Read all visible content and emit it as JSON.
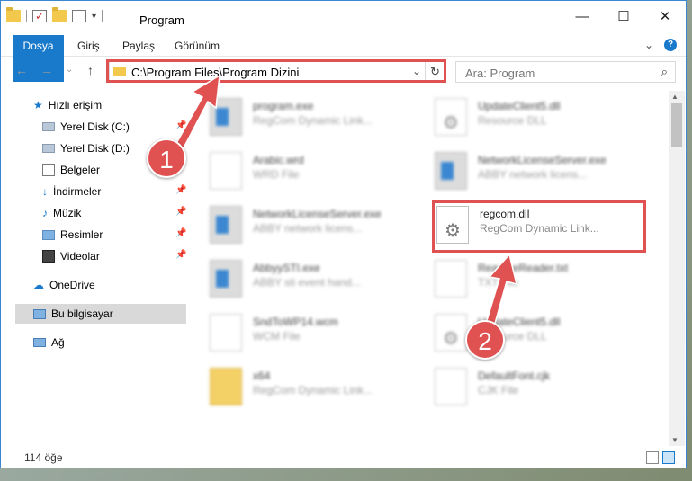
{
  "window": {
    "title": "Program",
    "controls": {
      "minimize": "—",
      "maximize": "☐",
      "close": "✕"
    }
  },
  "ribbon": {
    "tabs": [
      "Dosya",
      "Giriş",
      "Paylaş",
      "Görünüm"
    ],
    "expand": "⌄",
    "help": "?"
  },
  "address": {
    "path": "C:\\Program Files\\Program Dizini",
    "dropdown": "⌄",
    "refresh": "↻"
  },
  "search": {
    "placeholder": "Ara: Program",
    "icon": "search-icon"
  },
  "nav": {
    "back": "←",
    "forward": "→",
    "recent": "⌄",
    "up": "↑",
    "items": [
      {
        "label": "Hızlı erişim",
        "icon": "star-icon"
      },
      {
        "label": "Yerel Disk (C:)",
        "icon": "drive-icon"
      },
      {
        "label": "Yerel Disk (D:)",
        "icon": "drive-icon"
      },
      {
        "label": "Belgeler",
        "icon": "documents-icon"
      },
      {
        "label": "İndirmeler",
        "icon": "download-icon"
      },
      {
        "label": "Müzik",
        "icon": "music-icon"
      },
      {
        "label": "Resimler",
        "icon": "pictures-icon"
      },
      {
        "label": "Videolar",
        "icon": "video-icon"
      },
      {
        "label": "OneDrive",
        "icon": "cloud-icon"
      },
      {
        "label": "Bu bilgisayar",
        "icon": "computer-icon"
      },
      {
        "label": "Ağ",
        "icon": "network-icon"
      }
    ]
  },
  "files": [
    {
      "name": "program.exe",
      "desc": "RegCom Dynamic Link...",
      "type": "exe"
    },
    {
      "name": "UpdateClient5.dll",
      "desc": "Resource DLL",
      "type": "dll"
    },
    {
      "name": "Arabic.wrd",
      "desc": "WRD File",
      "type": "doc"
    },
    {
      "name": "NetworkLicenseServer.exe",
      "desc": "ABBY network licens...",
      "type": "exe"
    },
    {
      "name": "NetworkLicenseServer.exe",
      "desc": "ABBY network licens...",
      "type": "exe"
    },
    {
      "name": "regcom.dll",
      "desc": "RegCom Dynamic Link...",
      "type": "dll"
    },
    {
      "name": "AbbyySTI.exe",
      "desc": "ABBY sti event hand...",
      "type": "exe"
    },
    {
      "name": "ReadmeReader.txt",
      "desc": "TXT File",
      "type": "doc"
    },
    {
      "name": "SndToWP14.wcm",
      "desc": "WCM File",
      "type": "doc"
    },
    {
      "name": "UpdateClient5.dll",
      "desc": "Resource DLL",
      "type": "dll"
    },
    {
      "name": "x64",
      "desc": "RegCom Dynamic Link...",
      "type": "folder"
    },
    {
      "name": "DefaultFont.cjk",
      "desc": "CJK File",
      "type": "doc"
    }
  ],
  "status": {
    "count": "114 öğe"
  },
  "callouts": {
    "one": "1",
    "two": "2",
    "color": "#e05151"
  }
}
